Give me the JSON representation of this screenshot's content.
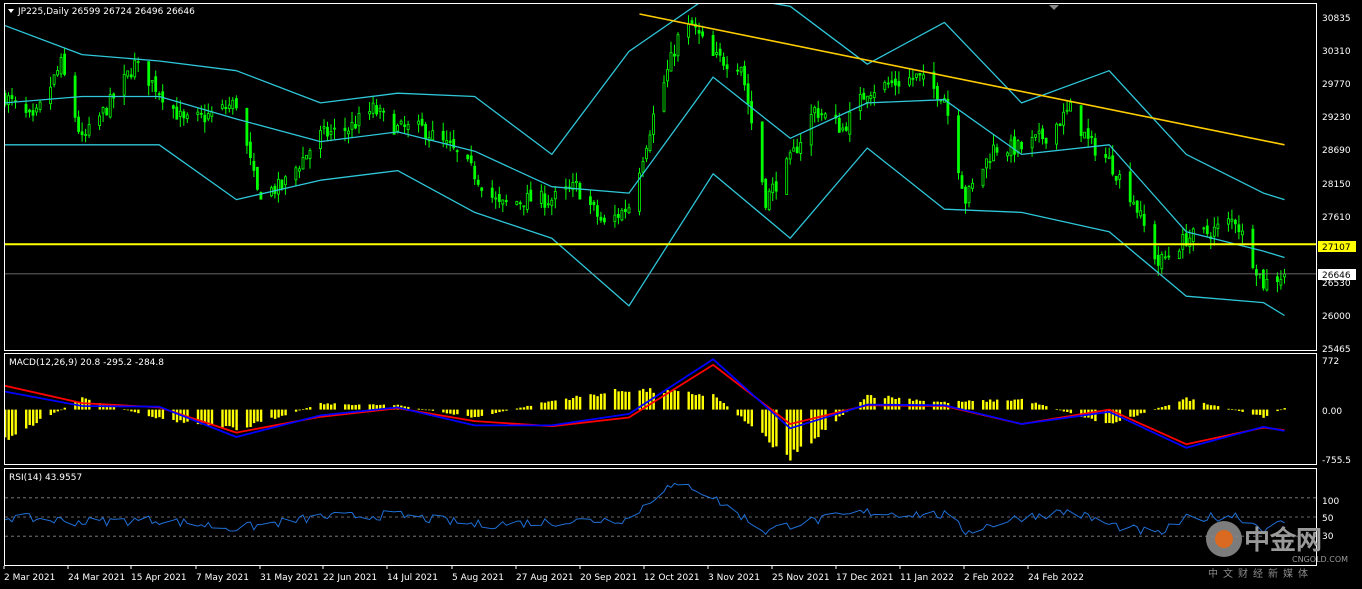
{
  "colors": {
    "background": "#000000",
    "frame": "#ffffff",
    "candle": "#00ff00",
    "bollinger": "#2ec6d8",
    "trendline": "#ffcc00",
    "support": "#ffff00",
    "histogram": "#ffff00",
    "macd_line": "#0000ff",
    "signal_line": "#ff0000",
    "rsi_line": "#1f6fd6",
    "level_line": "#888888"
  },
  "header": {
    "symbol_info": "JP225,Daily  26599 26724 26496 26646",
    "macd_info": "MACD(12,26,9) 20.8 -295.2 -284.8",
    "rsi_info": "RSI(14) 43.9557"
  },
  "price_scale": [
    "30835",
    "30310",
    "29770",
    "29230",
    "28690",
    "28150",
    "27610",
    "27107",
    "26530",
    "26000",
    "25465"
  ],
  "price_tags": {
    "support": "27107",
    "current": "26646"
  },
  "macd_scale": [
    "772",
    "0.00",
    "-755.5"
  ],
  "rsi_scale": [
    "100",
    "70",
    "50",
    "30",
    "0"
  ],
  "time_axis": [
    "2 Mar 2021",
    "24 Mar 2021",
    "15 Apr 2021",
    "7 May 2021",
    "31 May 2021",
    "22 Jun 2021",
    "14 Jul 2021",
    "5 Aug 2021",
    "27 Aug 2021",
    "20 Sep 2021",
    "12 Oct 2021",
    "3 Nov 2021",
    "25 Nov 2021",
    "17 Dec 2021",
    "11 Jan 2022",
    "2 Feb 2022",
    "24 Feb 2022"
  ],
  "watermark": {
    "name": "中金网",
    "url": "CNGOLD.COM",
    "subtitle": "中文财经新媒体"
  },
  "chart_data": [
    {
      "type": "candlestick",
      "symbol": "JP225",
      "timeframe": "Daily",
      "last_bar": {
        "open": 26599,
        "high": 26724,
        "low": 26496,
        "close": 26646
      },
      "ylim": [
        25465,
        30835
      ],
      "close_path": [
        {
          "date": "2 Mar 2021",
          "close": 29400
        },
        {
          "date": "10 Mar 2021",
          "close": 29000
        },
        {
          "date": "18 Mar 2021",
          "close": 29900
        },
        {
          "date": "24 Mar 2021",
          "close": 28700
        },
        {
          "date": "1 Apr 2021",
          "close": 29300
        },
        {
          "date": "8 Apr 2021",
          "close": 29900
        },
        {
          "date": "15 Apr 2021",
          "close": 29500
        },
        {
          "date": "22 Apr 2021",
          "close": 29000
        },
        {
          "date": "29 Apr 2021",
          "close": 29100
        },
        {
          "date": "7 May 2021",
          "close": 29300
        },
        {
          "date": "13 May 2021",
          "close": 27900
        },
        {
          "date": "20 May 2021",
          "close": 28000
        },
        {
          "date": "31 May 2021",
          "close": 28800
        },
        {
          "date": "8 Jun 2021",
          "close": 28900
        },
        {
          "date": "15 Jun 2021",
          "close": 29200
        },
        {
          "date": "22 Jun 2021",
          "close": 28900
        },
        {
          "date": "29 Jun 2021",
          "close": 28900
        },
        {
          "date": "7 Jul 2021",
          "close": 28600
        },
        {
          "date": "14 Jul 2021",
          "close": 28200
        },
        {
          "date": "21 Jul 2021",
          "close": 27700
        },
        {
          "date": "28 Jul 2021",
          "close": 27800
        },
        {
          "date": "5 Aug 2021",
          "close": 27800
        },
        {
          "date": "12 Aug 2021",
          "close": 28000
        },
        {
          "date": "20 Aug 2021",
          "close": 27400
        },
        {
          "date": "27 Aug 2021",
          "close": 27700
        },
        {
          "date": "3 Sep 2021",
          "close": 29100
        },
        {
          "date": "10 Sep 2021",
          "close": 30300
        },
        {
          "date": "14 Sep 2021",
          "close": 30500
        },
        {
          "date": "20 Sep 2021",
          "close": 30000
        },
        {
          "date": "28 Sep 2021",
          "close": 29900
        },
        {
          "date": "5 Oct 2021",
          "close": 27800
        },
        {
          "date": "12 Oct 2021",
          "close": 28400
        },
        {
          "date": "19 Oct 2021",
          "close": 29200
        },
        {
          "date": "27 Oct 2021",
          "close": 28900
        },
        {
          "date": "3 Nov 2021",
          "close": 29500
        },
        {
          "date": "10 Nov 2021",
          "close": 29600
        },
        {
          "date": "17 Nov 2021",
          "close": 29700
        },
        {
          "date": "25 Nov 2021",
          "close": 29400
        },
        {
          "date": "1 Dec 2021",
          "close": 27800
        },
        {
          "date": "9 Dec 2021",
          "close": 28600
        },
        {
          "date": "17 Dec 2021",
          "close": 28600
        },
        {
          "date": "24 Dec 2021",
          "close": 28800
        },
        {
          "date": "31 Dec 2021",
          "close": 29200
        },
        {
          "date": "5 Jan 2022",
          "close": 28700
        },
        {
          "date": "11 Jan 2022",
          "close": 28400
        },
        {
          "date": "18 Jan 2022",
          "close": 27800
        },
        {
          "date": "25 Jan 2022",
          "close": 26800
        },
        {
          "date": "2 Feb 2022",
          "close": 27200
        },
        {
          "date": "9 Feb 2022",
          "close": 27300
        },
        {
          "date": "16 Feb 2022",
          "close": 27500
        },
        {
          "date": "24 Feb 2022",
          "close": 26500
        },
        {
          "date": "2 Mar 2022",
          "close": 26646
        }
      ],
      "indicators": [
        {
          "name": "Bollinger Bands",
          "middle": [
            {
              "date": "2 Mar 2021",
              "value": 29300
            },
            {
              "date": "24 Mar 2021",
              "value": 29400
            },
            {
              "date": "15 Apr 2021",
              "value": 29400
            },
            {
              "date": "7 May 2021",
              "value": 29050
            },
            {
              "date": "31 May 2021",
              "value": 28700
            },
            {
              "date": "22 Jun 2021",
              "value": 28850
            },
            {
              "date": "14 Jul 2021",
              "value": 28550
            },
            {
              "date": "5 Aug 2021",
              "value": 28000
            },
            {
              "date": "27 Aug 2021",
              "value": 27900
            },
            {
              "date": "20 Sep 2021",
              "value": 29700
            },
            {
              "date": "12 Oct 2021",
              "value": 28750
            },
            {
              "date": "3 Nov 2021",
              "value": 29300
            },
            {
              "date": "25 Nov 2021",
              "value": 29350
            },
            {
              "date": "17 Dec 2021",
              "value": 28500
            },
            {
              "date": "11 Jan 2022",
              "value": 28650
            },
            {
              "date": "2 Feb 2022",
              "value": 27300
            },
            {
              "date": "24 Feb 2022",
              "value": 27000
            },
            {
              "date": "2 Mar 2022",
              "value": 26900
            }
          ],
          "upper": [
            {
              "date": "2 Mar 2021",
              "value": 30500
            },
            {
              "date": "24 Mar 2021",
              "value": 30050
            },
            {
              "date": "15 Apr 2021",
              "value": 29950
            },
            {
              "date": "7 May 2021",
              "value": 29800
            },
            {
              "date": "31 May 2021",
              "value": 29300
            },
            {
              "date": "22 Jun 2021",
              "value": 29450
            },
            {
              "date": "14 Jul 2021",
              "value": 29400
            },
            {
              "date": "5 Aug 2021",
              "value": 28500
            },
            {
              "date": "27 Aug 2021",
              "value": 30100
            },
            {
              "date": "20 Sep 2021",
              "value": 31000
            },
            {
              "date": "12 Oct 2021",
              "value": 30800
            },
            {
              "date": "3 Nov 2021",
              "value": 29900
            },
            {
              "date": "25 Nov 2021",
              "value": 30550
            },
            {
              "date": "17 Dec 2021",
              "value": 29300
            },
            {
              "date": "11 Jan 2022",
              "value": 29800
            },
            {
              "date": "2 Feb 2022",
              "value": 28500
            },
            {
              "date": "24 Feb 2022",
              "value": 27900
            },
            {
              "date": "2 Mar 2022",
              "value": 27800
            }
          ],
          "lower": [
            {
              "date": "2 Mar 2021",
              "value": 28650
            },
            {
              "date": "24 Mar 2021",
              "value": 28650
            },
            {
              "date": "15 Apr 2021",
              "value": 28650
            },
            {
              "date": "7 May 2021",
              "value": 27800
            },
            {
              "date": "31 May 2021",
              "value": 28100
            },
            {
              "date": "22 Jun 2021",
              "value": 28250
            },
            {
              "date": "14 Jul 2021",
              "value": 27600
            },
            {
              "date": "5 Aug 2021",
              "value": 27200
            },
            {
              "date": "27 Aug 2021",
              "value": 26150
            },
            {
              "date": "20 Sep 2021",
              "value": 28200
            },
            {
              "date": "12 Oct 2021",
              "value": 27200
            },
            {
              "date": "3 Nov 2021",
              "value": 28600
            },
            {
              "date": "25 Nov 2021",
              "value": 27650
            },
            {
              "date": "17 Dec 2021",
              "value": 27600
            },
            {
              "date": "11 Jan 2022",
              "value": 27300
            },
            {
              "date": "2 Feb 2022",
              "value": 26300
            },
            {
              "date": "24 Feb 2022",
              "value": 26200
            },
            {
              "date": "2 Mar 2022",
              "value": 26000
            }
          ]
        }
      ],
      "annotations": [
        {
          "type": "horizontal-line",
          "value": 27107
        },
        {
          "type": "horizontal-line",
          "value": 26646
        },
        {
          "type": "trendline",
          "from": {
            "date": "30 Aug 2021",
            "value": 30680
          },
          "to": {
            "date": "2 Mar 2022",
            "value": 28650
          }
        }
      ]
    },
    {
      "type": "histogram-line",
      "indicator": "MACD(12,26,9)",
      "values": {
        "histogram": 20.8,
        "macd": -295.2,
        "signal": -284.8
      },
      "ylim": [
        -755.5,
        772
      ],
      "histogram_path": [
        {
          "date": "2 Mar 2021",
          "value": -400
        },
        {
          "date": "24 Mar 2021",
          "value": 150
        },
        {
          "date": "15 Apr 2021",
          "value": -120
        },
        {
          "date": "7 May 2021",
          "value": -280
        },
        {
          "date": "31 May 2021",
          "value": 80
        },
        {
          "date": "22 Jun 2021",
          "value": 60
        },
        {
          "date": "14 Jul 2021",
          "value": -110
        },
        {
          "date": "5 Aug 2021",
          "value": 120
        },
        {
          "date": "27 Aug 2021",
          "value": 280
        },
        {
          "date": "20 Sep 2021",
          "value": 200
        },
        {
          "date": "12 Oct 2021",
          "value": -650
        },
        {
          "date": "3 Nov 2021",
          "value": 200
        },
        {
          "date": "25 Nov 2021",
          "value": 100
        },
        {
          "date": "17 Dec 2021",
          "value": 140
        },
        {
          "date": "11 Jan 2022",
          "value": -200
        },
        {
          "date": "2 Feb 2022",
          "value": 150
        },
        {
          "date": "24 Feb 2022",
          "value": -100
        },
        {
          "date": "2 Mar 2022",
          "value": 20.8
        }
      ],
      "macd_path": [
        {
          "date": "2 Mar 2021",
          "value": 250
        },
        {
          "date": "24 Mar 2021",
          "value": 50
        },
        {
          "date": "15 Apr 2021",
          "value": 40
        },
        {
          "date": "7 May 2021",
          "value": -380
        },
        {
          "date": "31 May 2021",
          "value": -80
        },
        {
          "date": "22 Jun 2021",
          "value": 30
        },
        {
          "date": "14 Jul 2021",
          "value": -220
        },
        {
          "date": "5 Aug 2021",
          "value": -220
        },
        {
          "date": "27 Aug 2021",
          "value": -60
        },
        {
          "date": "20 Sep 2021",
          "value": 700
        },
        {
          "date": "12 Oct 2021",
          "value": -260
        },
        {
          "date": "3 Nov 2021",
          "value": 70
        },
        {
          "date": "25 Nov 2021",
          "value": 60
        },
        {
          "date": "17 Dec 2021",
          "value": -200
        },
        {
          "date": "11 Jan 2022",
          "value": -30
        },
        {
          "date": "2 Feb 2022",
          "value": -530
        },
        {
          "date": "24 Feb 2022",
          "value": -240
        },
        {
          "date": "2 Mar 2022",
          "value": -295.2
        }
      ],
      "signal_path": [
        {
          "date": "2 Mar 2021",
          "value": 330
        },
        {
          "date": "24 Mar 2021",
          "value": 90
        },
        {
          "date": "15 Apr 2021",
          "value": 30
        },
        {
          "date": "7 May 2021",
          "value": -320
        },
        {
          "date": "31 May 2021",
          "value": -100
        },
        {
          "date": "22 Jun 2021",
          "value": 20
        },
        {
          "date": "14 Jul 2021",
          "value": -160
        },
        {
          "date": "5 Aug 2021",
          "value": -230
        },
        {
          "date": "27 Aug 2021",
          "value": -110
        },
        {
          "date": "20 Sep 2021",
          "value": 620
        },
        {
          "date": "12 Oct 2021",
          "value": -200
        },
        {
          "date": "3 Nov 2021",
          "value": 60
        },
        {
          "date": "25 Nov 2021",
          "value": 50
        },
        {
          "date": "17 Dec 2021",
          "value": -200
        },
        {
          "date": "11 Jan 2022",
          "value": 0
        },
        {
          "date": "2 Feb 2022",
          "value": -480
        },
        {
          "date": "24 Feb 2022",
          "value": -250
        },
        {
          "date": "2 Mar 2022",
          "value": -284.8
        }
      ]
    },
    {
      "type": "line",
      "indicator": "RSI(14)",
      "last_value": 43.9557,
      "ylim": [
        0,
        100
      ],
      "levels": [
        70,
        50,
        30
      ],
      "values": [
        {
          "date": "2 Mar 2021",
          "value": 50
        },
        {
          "date": "24 Mar 2021",
          "value": 45
        },
        {
          "date": "15 Apr 2021",
          "value": 47
        },
        {
          "date": "7 May 2021",
          "value": 38
        },
        {
          "date": "31 May 2021",
          "value": 50
        },
        {
          "date": "22 Jun 2021",
          "value": 52
        },
        {
          "date": "14 Jul 2021",
          "value": 42
        },
        {
          "date": "5 Aug 2021",
          "value": 45
        },
        {
          "date": "27 Aug 2021",
          "value": 48
        },
        {
          "date": "6 Sep 2021",
          "value": 80
        },
        {
          "date": "14 Sep 2021",
          "value": 82
        },
        {
          "date": "20 Sep 2021",
          "value": 70
        },
        {
          "date": "5 Oct 2021",
          "value": 35
        },
        {
          "date": "12 Oct 2021",
          "value": 42
        },
        {
          "date": "3 Nov 2021",
          "value": 55
        },
        {
          "date": "25 Nov 2021",
          "value": 52
        },
        {
          "date": "1 Dec 2021",
          "value": 35
        },
        {
          "date": "17 Dec 2021",
          "value": 50
        },
        {
          "date": "31 Dec 2021",
          "value": 56
        },
        {
          "date": "11 Jan 2022",
          "value": 42
        },
        {
          "date": "25 Jan 2022",
          "value": 32
        },
        {
          "date": "2 Feb 2022",
          "value": 48
        },
        {
          "date": "16 Feb 2022",
          "value": 52
        },
        {
          "date": "24 Feb 2022",
          "value": 38
        },
        {
          "date": "2 Mar 2022",
          "value": 43.9557
        }
      ]
    }
  ]
}
